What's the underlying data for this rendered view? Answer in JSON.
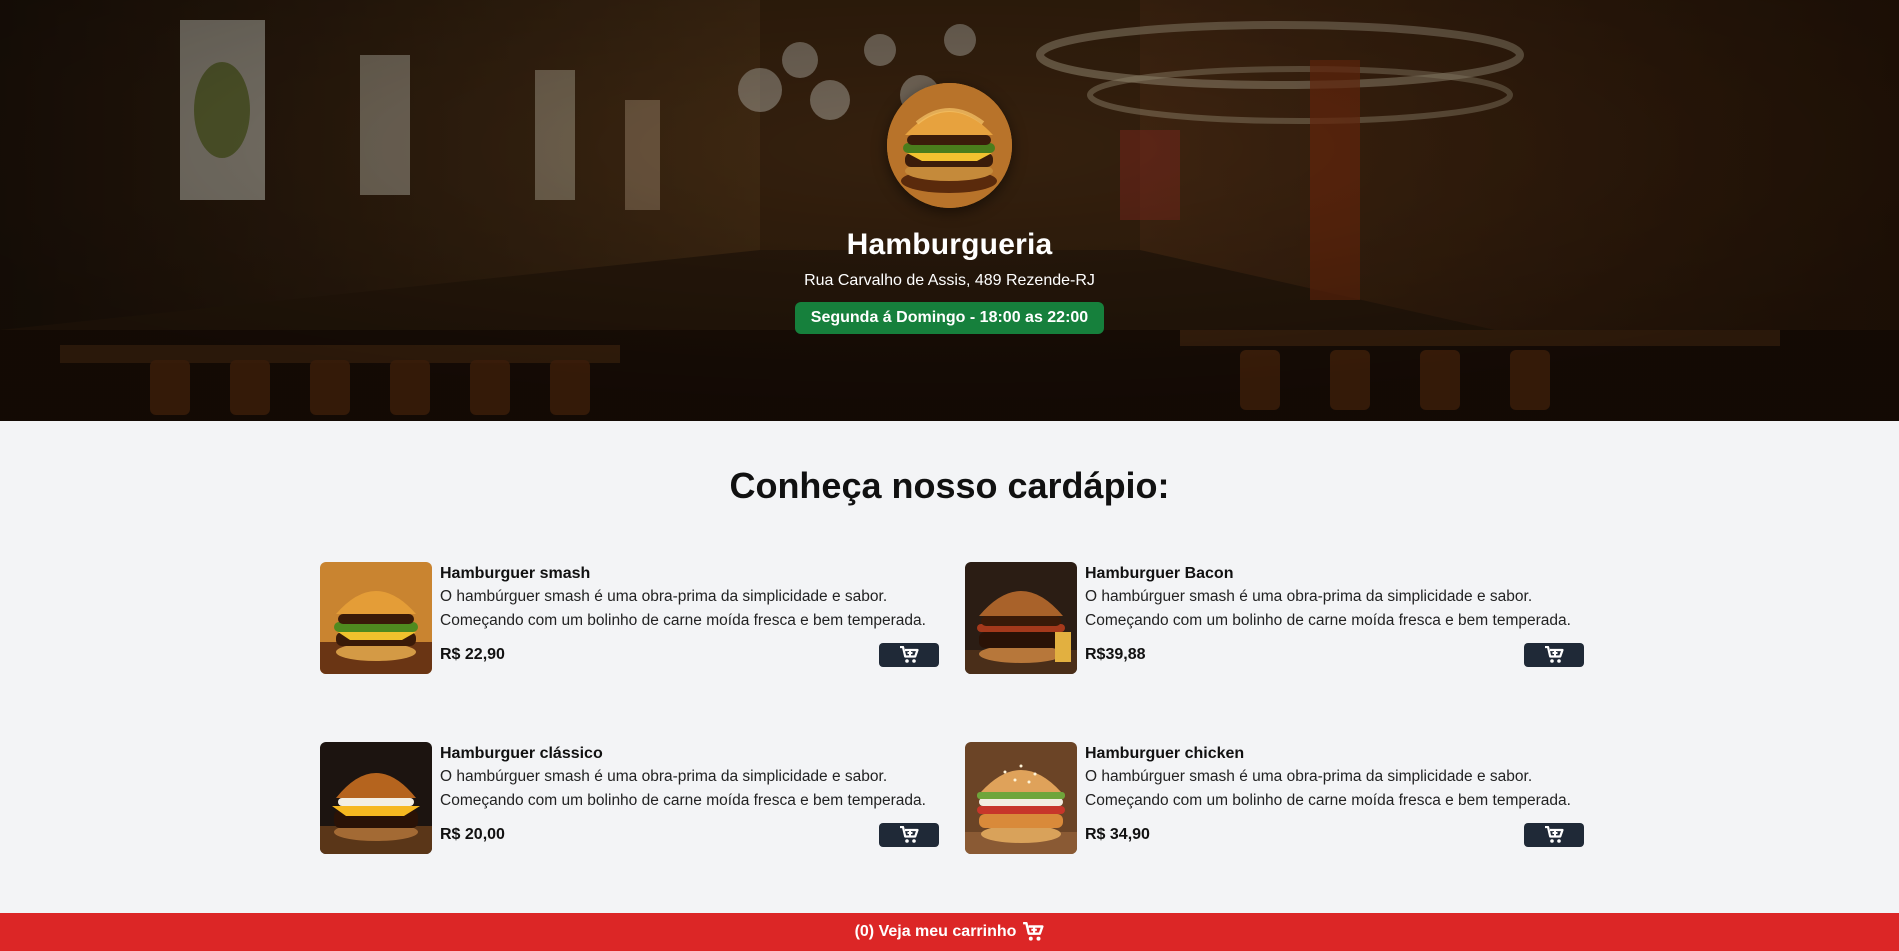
{
  "restaurant": {
    "name": "Hamburgueria",
    "address": "Rua Carvalho de Assis, 489 Rezende-RJ",
    "hours": "Segunda á Domingo - 18:00 as 22:00",
    "logo_icon": "burger-image"
  },
  "menu": {
    "title": "Conheça nosso cardápio:",
    "items": [
      {
        "name": "Hamburguer smash",
        "description": "O hambúrguer smash é uma obra-prima da simplicidade e sabor. Começando com um bolinho de carne moída fresca e bem temperada.",
        "price": "R$ 22,90",
        "image": "burger-smash-image"
      },
      {
        "name": "Hamburguer Bacon",
        "description": "O hambúrguer smash é uma obra-prima da simplicidade e sabor. Começando com um bolinho de carne moída fresca e bem temperada.",
        "price": "R$39,88",
        "image": "burger-bacon-image"
      },
      {
        "name": "Hamburguer clássico",
        "description": "O hambúrguer smash é uma obra-prima da simplicidade e sabor. Começando com um bolinho de carne moída fresca e bem temperada.",
        "price": "R$ 20,00",
        "image": "burger-classic-image"
      },
      {
        "name": "Hamburguer chicken",
        "description": "O hambúrguer smash é uma obra-prima da simplicidade e sabor. Começando com um bolinho de carne moída fresca e bem temperada.",
        "price": "R$ 34,90",
        "image": "burger-chicken-image"
      }
    ],
    "add_button_icon": "cart-plus-icon"
  },
  "cart": {
    "label": "(0) Veja meu carrinho",
    "icon": "cart-plus-icon"
  },
  "colors": {
    "hours_badge": "#16803c",
    "add_button": "#1f2937",
    "cart_bar": "#dc2626",
    "page_bg": "#f3f4f6"
  }
}
